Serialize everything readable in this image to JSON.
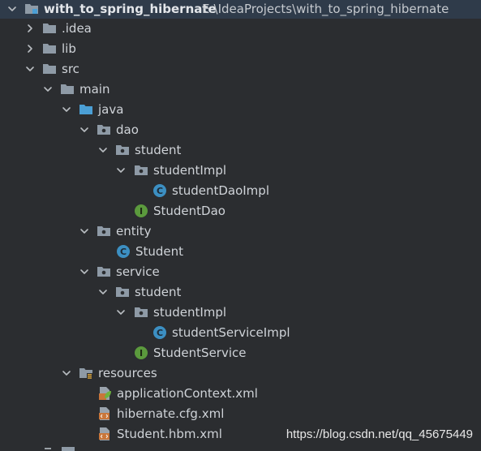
{
  "project": {
    "name": "with_to_spring_hibernate",
    "path": "E:\\IdeaProjects\\with_to_spring_hibernate"
  },
  "nodes": {
    "idea": ".idea",
    "lib": "lib",
    "src": "src",
    "main": "main",
    "java": "java",
    "dao": "dao",
    "dao_student": "student",
    "dao_studentImpl": "studentImpl",
    "studentDaoImpl": "studentDaoImpl",
    "StudentDao": "StudentDao",
    "entity": "entity",
    "Student": "Student",
    "service": "service",
    "service_student": "student",
    "service_studentImpl": "studentImpl",
    "studentServiceImpl": "studentServiceImpl",
    "StudentService": "StudentService",
    "resources": "resources",
    "applicationContext": "applicationContext.xml",
    "hibernate_cfg": "hibernate.cfg.xml",
    "student_hbm": "Student.hbm.xml"
  },
  "icon_letters": {
    "class": "C",
    "interface": "I"
  },
  "watermark": "https://blog.csdn.net/qq_45675449",
  "colors": {
    "background": "#2b2d30",
    "selected_row": "#2f3b4a",
    "folder": "#8e9aa6",
    "source_folder": "#4b9fd5",
    "class_icon": "#3c8fc2",
    "interface_icon": "#5b9a3d",
    "xml_icon": "#c9763a",
    "spring_leaf": "#6db33f",
    "text": "#cfd3d8"
  }
}
